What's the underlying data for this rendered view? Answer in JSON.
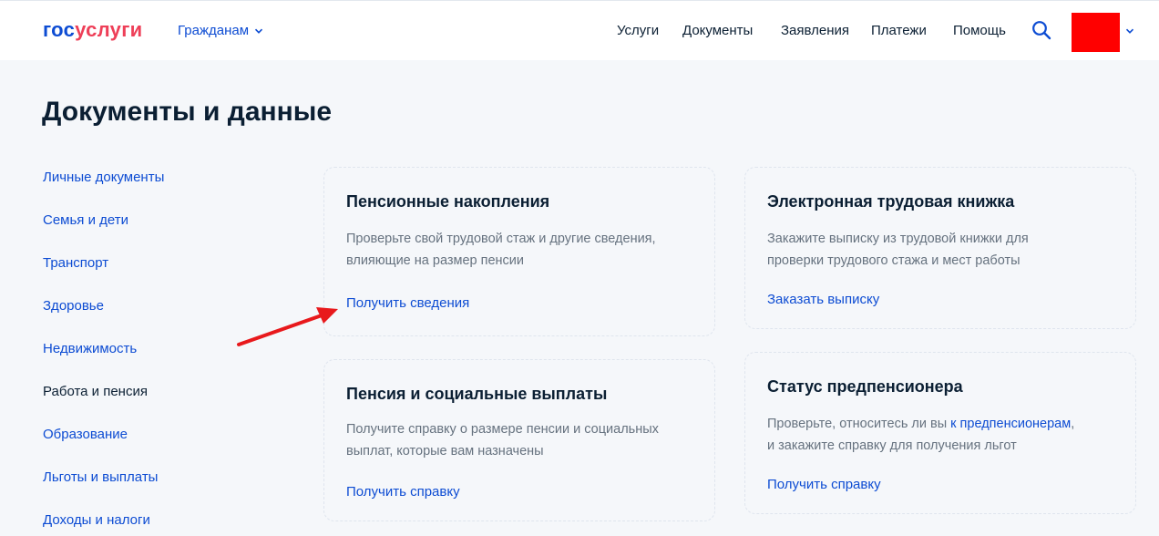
{
  "header": {
    "logo_part1": "гос",
    "logo_part2": "услуги",
    "audience_label": "Гражданам",
    "nav": [
      "Услуги",
      "Документы",
      "Заявления",
      "Платежи",
      "Помощь"
    ],
    "icons": {
      "search": "search-icon",
      "chevron": "chevron-down-icon"
    }
  },
  "page": {
    "title": "Документы и данные"
  },
  "sidebar": {
    "items": [
      {
        "label": "Личные документы"
      },
      {
        "label": "Семья и дети"
      },
      {
        "label": "Транспорт"
      },
      {
        "label": "Здоровье"
      },
      {
        "label": "Недвижимость"
      },
      {
        "label": "Работа и пенсия",
        "active": true
      },
      {
        "label": "Образование"
      },
      {
        "label": "Льготы и выплаты"
      },
      {
        "label": "Доходы и налоги"
      }
    ]
  },
  "cards": [
    {
      "title": "Пенсионные накопления",
      "desc_line1": "Проверьте свой трудовой стаж и другие сведения,",
      "desc_line2": "влияющие на размер пенсии",
      "link": "Получить сведения"
    },
    {
      "title": "Электронная трудовая книжка",
      "desc_line1": "Закажите выписку из трудовой книжки для",
      "desc_line2": "проверки трудового стажа и мест работы",
      "link": "Заказать выписку"
    },
    {
      "title": "Пенсия и социальные выплаты",
      "desc_line1": "Получите справку о размере пенсии и социальных",
      "desc_line2": "выплат, которые вам назначены",
      "link": "Получить справку"
    },
    {
      "title": "Статус предпенсионера",
      "desc_line1_a": "Проверьте, относитесь ли вы ",
      "desc_line1_link": "к предпенсионерам",
      "desc_line1_b": ",",
      "desc_line2": "и закажите справку для получения льгот",
      "link": "Получить справку"
    }
  ],
  "colors": {
    "brand_blue": "#0d4cd3",
    "brand_red": "#ee3f58",
    "avatar": "#ff0000",
    "annotation_arrow": "#e8191c"
  }
}
